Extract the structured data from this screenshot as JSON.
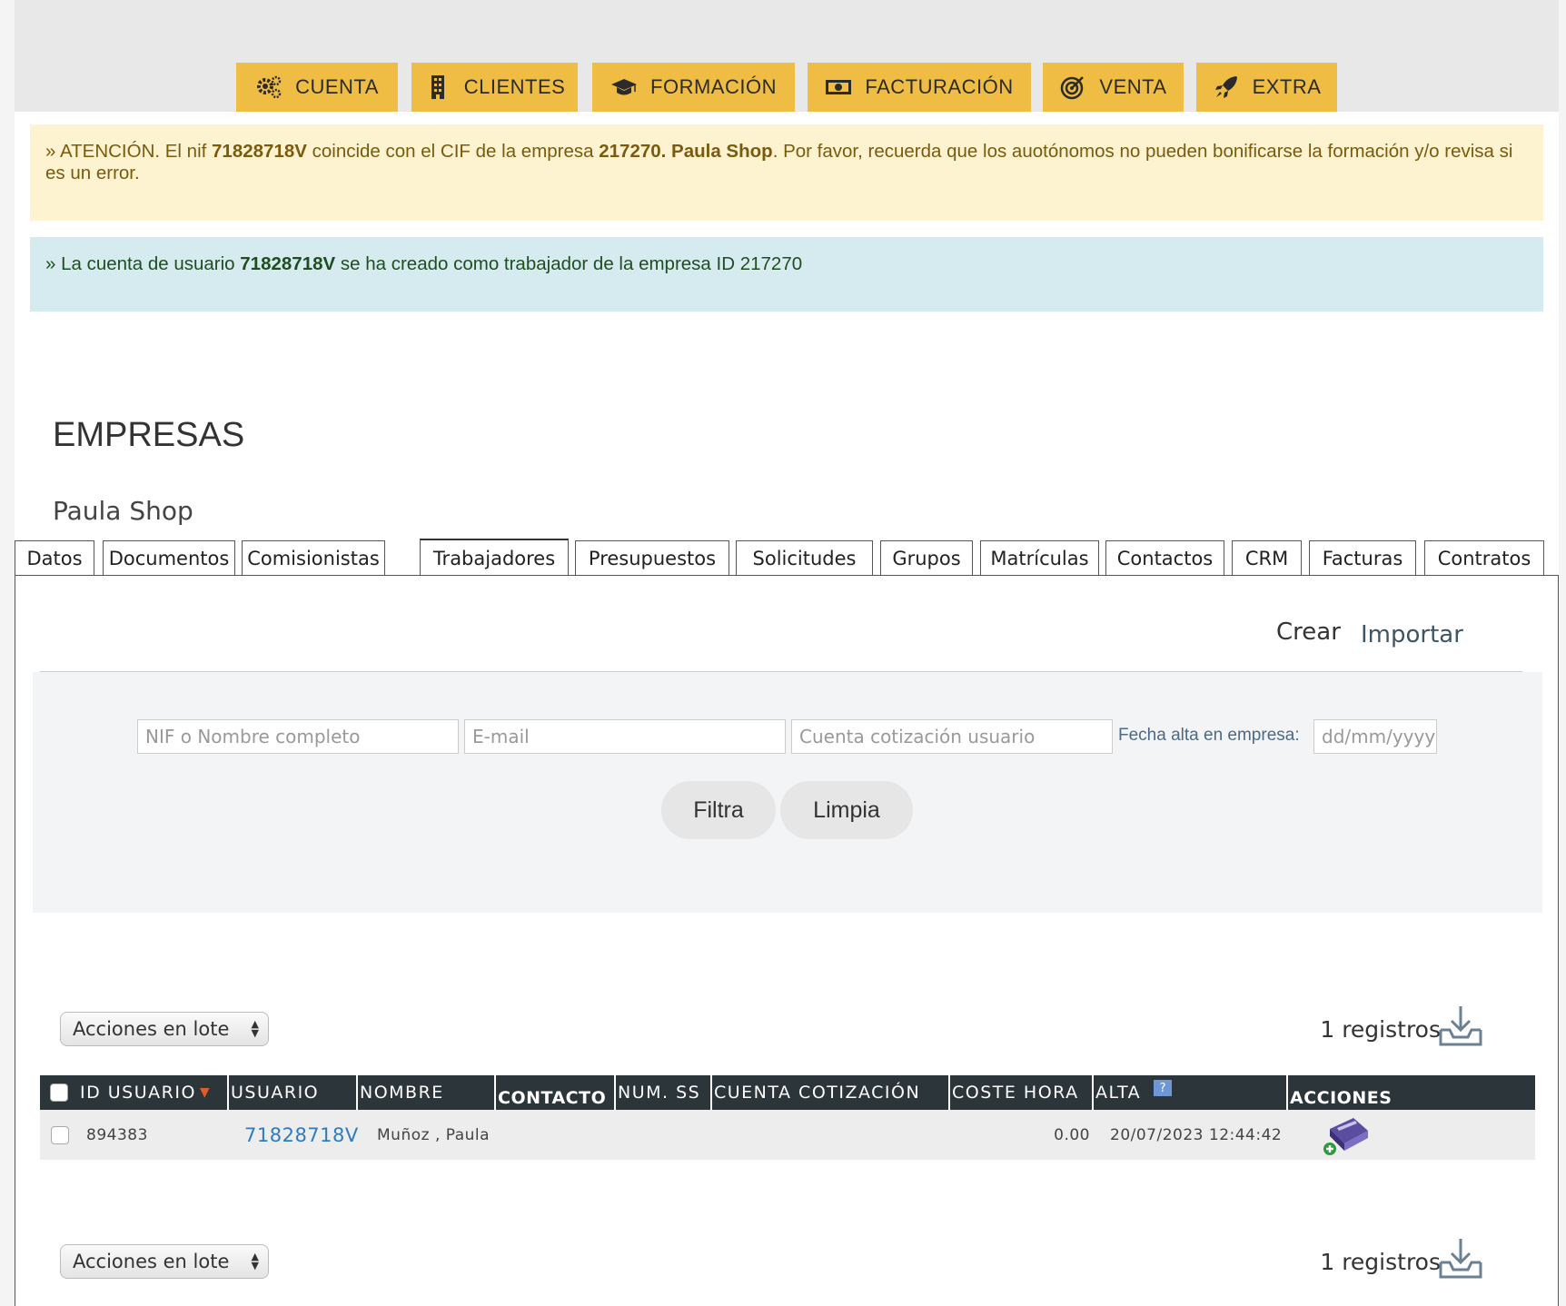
{
  "nav": {
    "items": [
      {
        "label": "CUENTA",
        "icon": "gears-icon"
      },
      {
        "label": "CLIENTES",
        "icon": "building-icon"
      },
      {
        "label": "FORMACIÓN",
        "icon": "graduation-cap-icon"
      },
      {
        "label": "FACTURACIÓN",
        "icon": "money-icon"
      },
      {
        "label": "VENTA",
        "icon": "target-icon"
      },
      {
        "label": "EXTRA",
        "icon": "rocket-icon"
      }
    ],
    "color": "#f0bd44"
  },
  "alerts": {
    "warning": {
      "prefix": "» ATENCIÓN. El nif ",
      "nif": "71828718V",
      "mid": " coincide con el CIF de la empresa ",
      "company": "217270. Paula Shop",
      "suffix": ". Por favor, recuerda que los auotónomos no pueden bonificarse la formación y/o revisa si es un error."
    },
    "info": {
      "prefix": "» La cuenta de usuario ",
      "user": "71828718V",
      "suffix": " se ha creado como trabajador de la empresa ID 217270"
    }
  },
  "page": {
    "title": "EMPRESAS",
    "subtitle": "Paula Shop"
  },
  "tabs": [
    "Datos",
    "Documentos",
    "Comisionistas",
    "Trabajadores",
    "Presupuestos",
    "Solicitudes",
    "Grupos",
    "Matrículas",
    "Contactos",
    "CRM",
    "Facturas",
    "Contratos"
  ],
  "active_tab": "Trabajadores",
  "toolbar": {
    "create": "Crear",
    "import": "Importar"
  },
  "filters": {
    "nif_placeholder": "NIF o Nombre completo",
    "email_placeholder": "E-mail",
    "cuenta_placeholder": "Cuenta cotización usuario",
    "fecha_label": "Fecha alta en empresa:",
    "fecha_placeholder": "dd/mm/yyyy",
    "filter_button": "Filtra",
    "clear_button": "Limpia"
  },
  "bulk": {
    "select_label": "Acciones en lote",
    "records_text": "1 registros"
  },
  "table": {
    "headers": [
      "ID USUARIO",
      "USUARIO",
      "NOMBRE",
      "CONTACTO",
      "NUM. SS",
      "CUENTA COTIZACIÓN",
      "COSTE HORA",
      "ALTA",
      "ACCIONES"
    ],
    "help_icon": "?",
    "rows": [
      {
        "id": "894383",
        "usuario": "71828718V",
        "nombre": "Muñoz , Paula",
        "contacto": "",
        "num_ss": "",
        "cuenta": "",
        "coste": "0.00",
        "alta": "20/07/2023 12:44:42"
      }
    ]
  }
}
